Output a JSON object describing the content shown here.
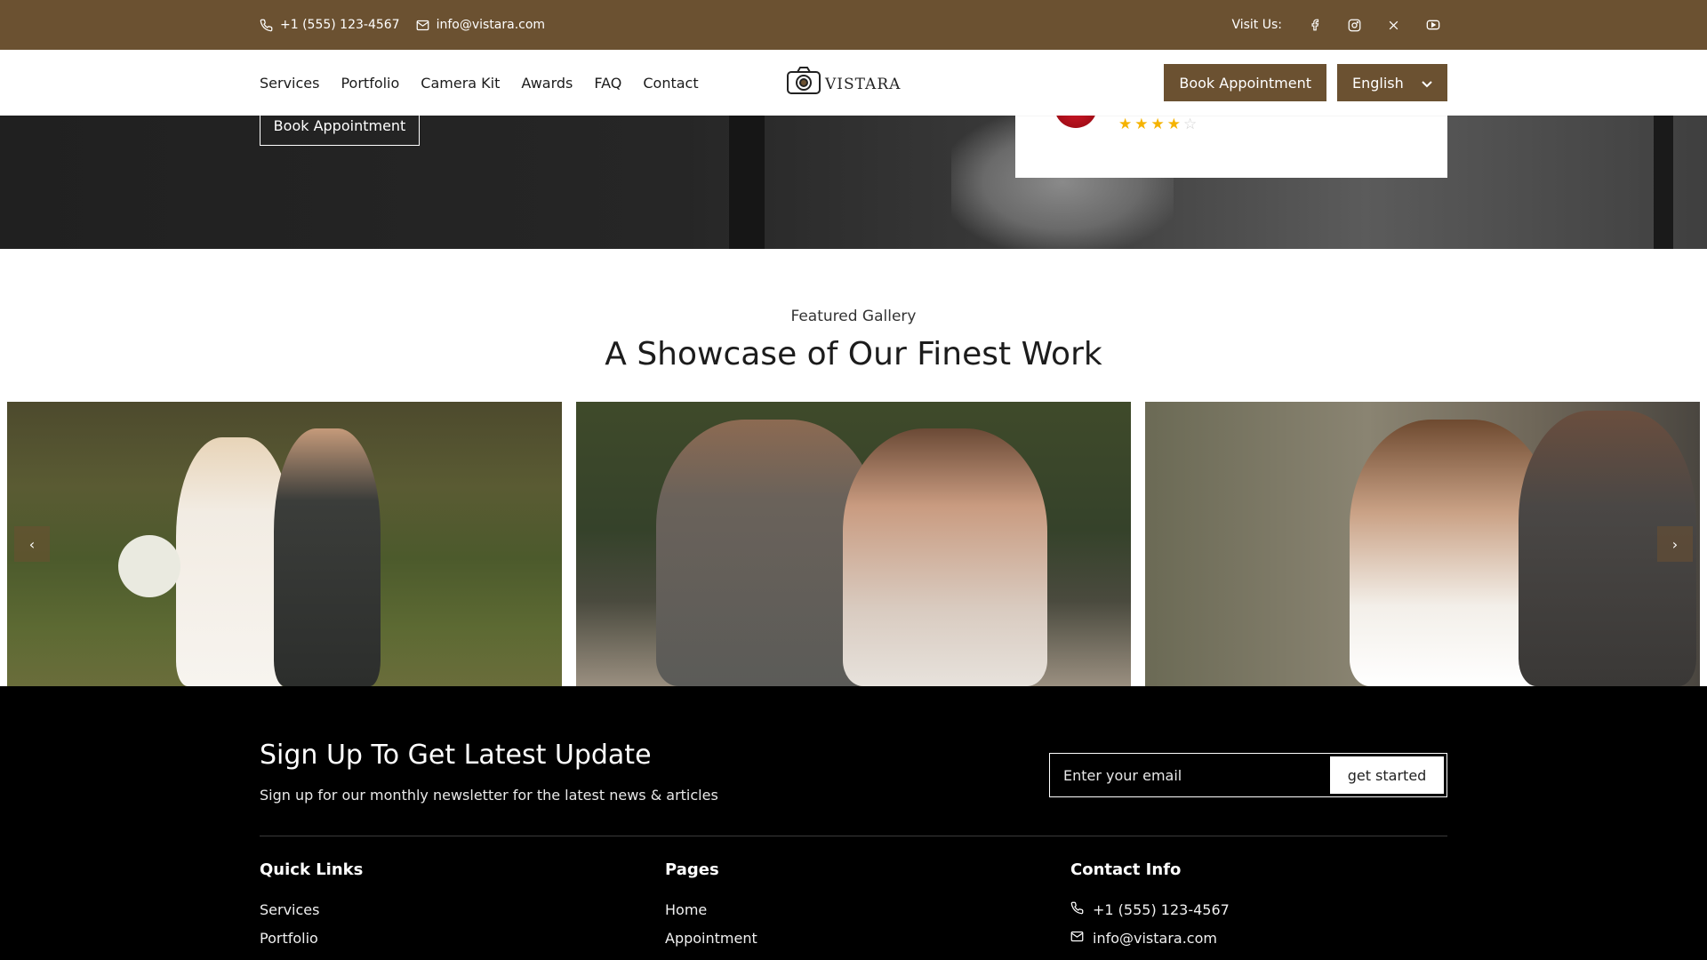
{
  "topbar": {
    "phone": "+1 (555) 123-4567",
    "email": "info@vistara.com",
    "visit_label": "Visit Us:",
    "socials": [
      "facebook-icon",
      "instagram-icon",
      "x-icon",
      "youtube-icon"
    ]
  },
  "nav": {
    "links": [
      "Services",
      "Portfolio",
      "Camera Kit",
      "Awards",
      "FAQ",
      "Contact"
    ],
    "logo_text": "VISTARA",
    "book_label": "Book Appointment",
    "language": "English"
  },
  "hero": {
    "book_label": "Book Appointment",
    "review_rating": 4,
    "review_max": 5
  },
  "gallery": {
    "eyebrow": "Featured Gallery",
    "title": "A Showcase of Our Finest Work",
    "prev": "‹",
    "next": "›"
  },
  "newsletter": {
    "title": "Sign Up To Get Latest Update",
    "subtitle": "Sign up for our monthly newsletter for the latest news & articles",
    "placeholder": "Enter your email",
    "button": "get started"
  },
  "footer": {
    "quick_links_title": "Quick Links",
    "quick_links": [
      "Services",
      "Portfolio"
    ],
    "pages_title": "Pages",
    "pages": [
      "Home",
      "Appointment"
    ],
    "contact_title": "Contact Info",
    "contact_phone": "+1 (555) 123-4567",
    "contact_email": "info@vistara.com"
  },
  "colors": {
    "brand": "#6b5131",
    "star": "#f5b301",
    "footer_bg": "#000000"
  }
}
